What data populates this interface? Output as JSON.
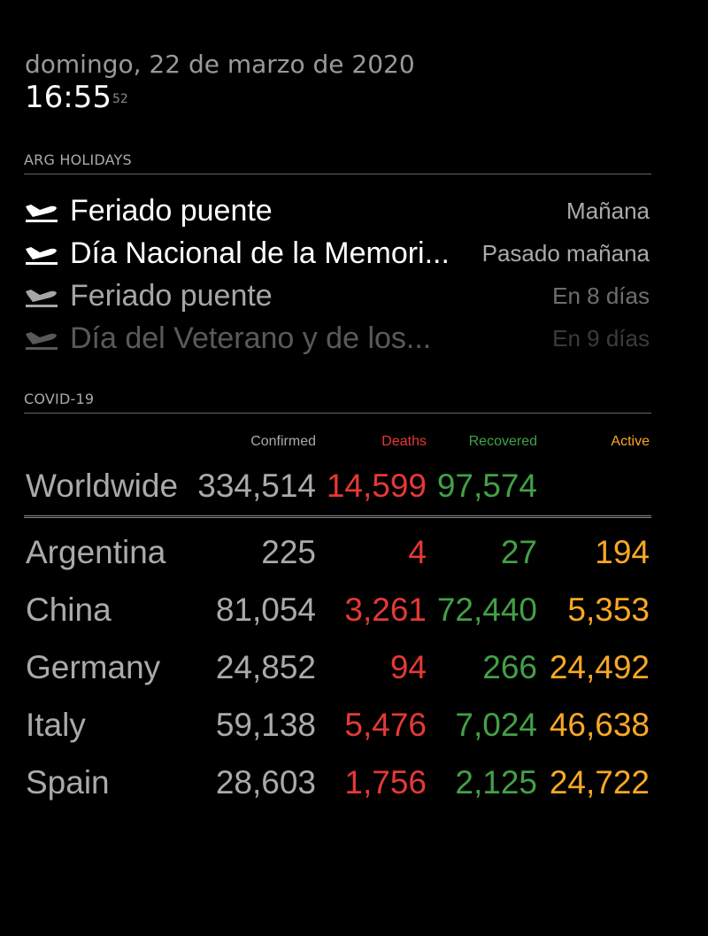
{
  "clock": {
    "date": "domingo, 22 de marzo de 2020",
    "time": "16:55",
    "seconds": "52"
  },
  "calendar": {
    "header": "ARG HOLIDAYS",
    "events": [
      {
        "title": "Feriado puente",
        "when": "Mañana"
      },
      {
        "title": "Día Nacional de la Memori...",
        "when": "Pasado mañana"
      },
      {
        "title": "Feriado puente",
        "when": "En 8 días"
      },
      {
        "title": "Día del Veterano y de los...",
        "when": "En 9 días"
      }
    ],
    "icon": "airplane-arrival-icon"
  },
  "covid": {
    "header": "COVID-19",
    "columns": {
      "confirmed": "Confirmed",
      "deaths": "Deaths",
      "recovered": "Recovered",
      "active": "Active"
    },
    "worldwide": {
      "name": "Worldwide",
      "confirmed": "334,514",
      "deaths": "14,599",
      "recovered": "97,574",
      "active": ""
    },
    "countries": [
      {
        "name": "Argentina",
        "confirmed": "225",
        "deaths": "4",
        "recovered": "27",
        "active": "194"
      },
      {
        "name": "China",
        "confirmed": "81,054",
        "deaths": "3,261",
        "recovered": "72,440",
        "active": "5,353"
      },
      {
        "name": "Germany",
        "confirmed": "24,852",
        "deaths": "94",
        "recovered": "266",
        "active": "24,492"
      },
      {
        "name": "Italy",
        "confirmed": "59,138",
        "deaths": "5,476",
        "recovered": "7,024",
        "active": "46,638"
      },
      {
        "name": "Spain",
        "confirmed": "28,603",
        "deaths": "1,756",
        "recovered": "2,125",
        "active": "24,722"
      }
    ],
    "colors": {
      "deaths": "#e53935",
      "recovered": "#43a047",
      "active": "#f9a825"
    }
  }
}
